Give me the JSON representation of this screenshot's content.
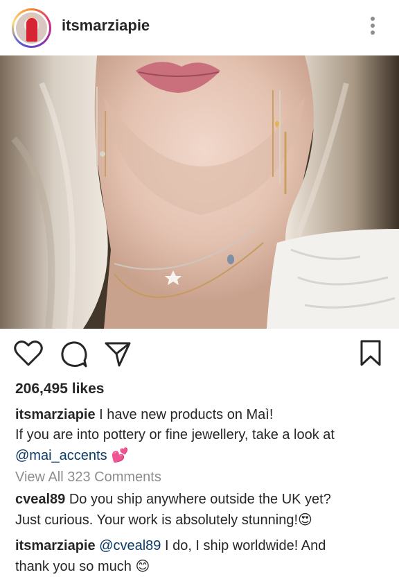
{
  "post": {
    "username": "itsmarziapie",
    "likes": "206,495 likes",
    "caption": {
      "user": "itsmarziapie",
      "line1": " I have new products on Maì!",
      "line2": "If you are into pottery or fine jewellery, take a look at",
      "mention": "@mai_accents",
      "emoji": " 💕"
    },
    "view_all_comments": "View All 323 Comments",
    "comments": [
      {
        "user": "cveal89",
        "text_line1": " Do you ship anywhere outside the UK yet?",
        "text_line2": "Just curious. Your work is absolutely  stunning!",
        "emoji": "😍"
      },
      {
        "user": "itsmarziapie",
        "mention": " @cveal89",
        "text_line1": " I do, I ship worldwide! And",
        "text_line2": "thank you so much ",
        "emoji": "😊"
      }
    ]
  },
  "icons": {
    "avatar": "profile-avatar",
    "more": "more-vertical-icon",
    "like": "heart-icon",
    "comment": "comment-bubble-icon",
    "share": "paper-plane-icon",
    "save": "bookmark-icon"
  },
  "colors": {
    "text": "#262626",
    "muted": "#8e8e8e",
    "mention": "#0b3a66"
  }
}
